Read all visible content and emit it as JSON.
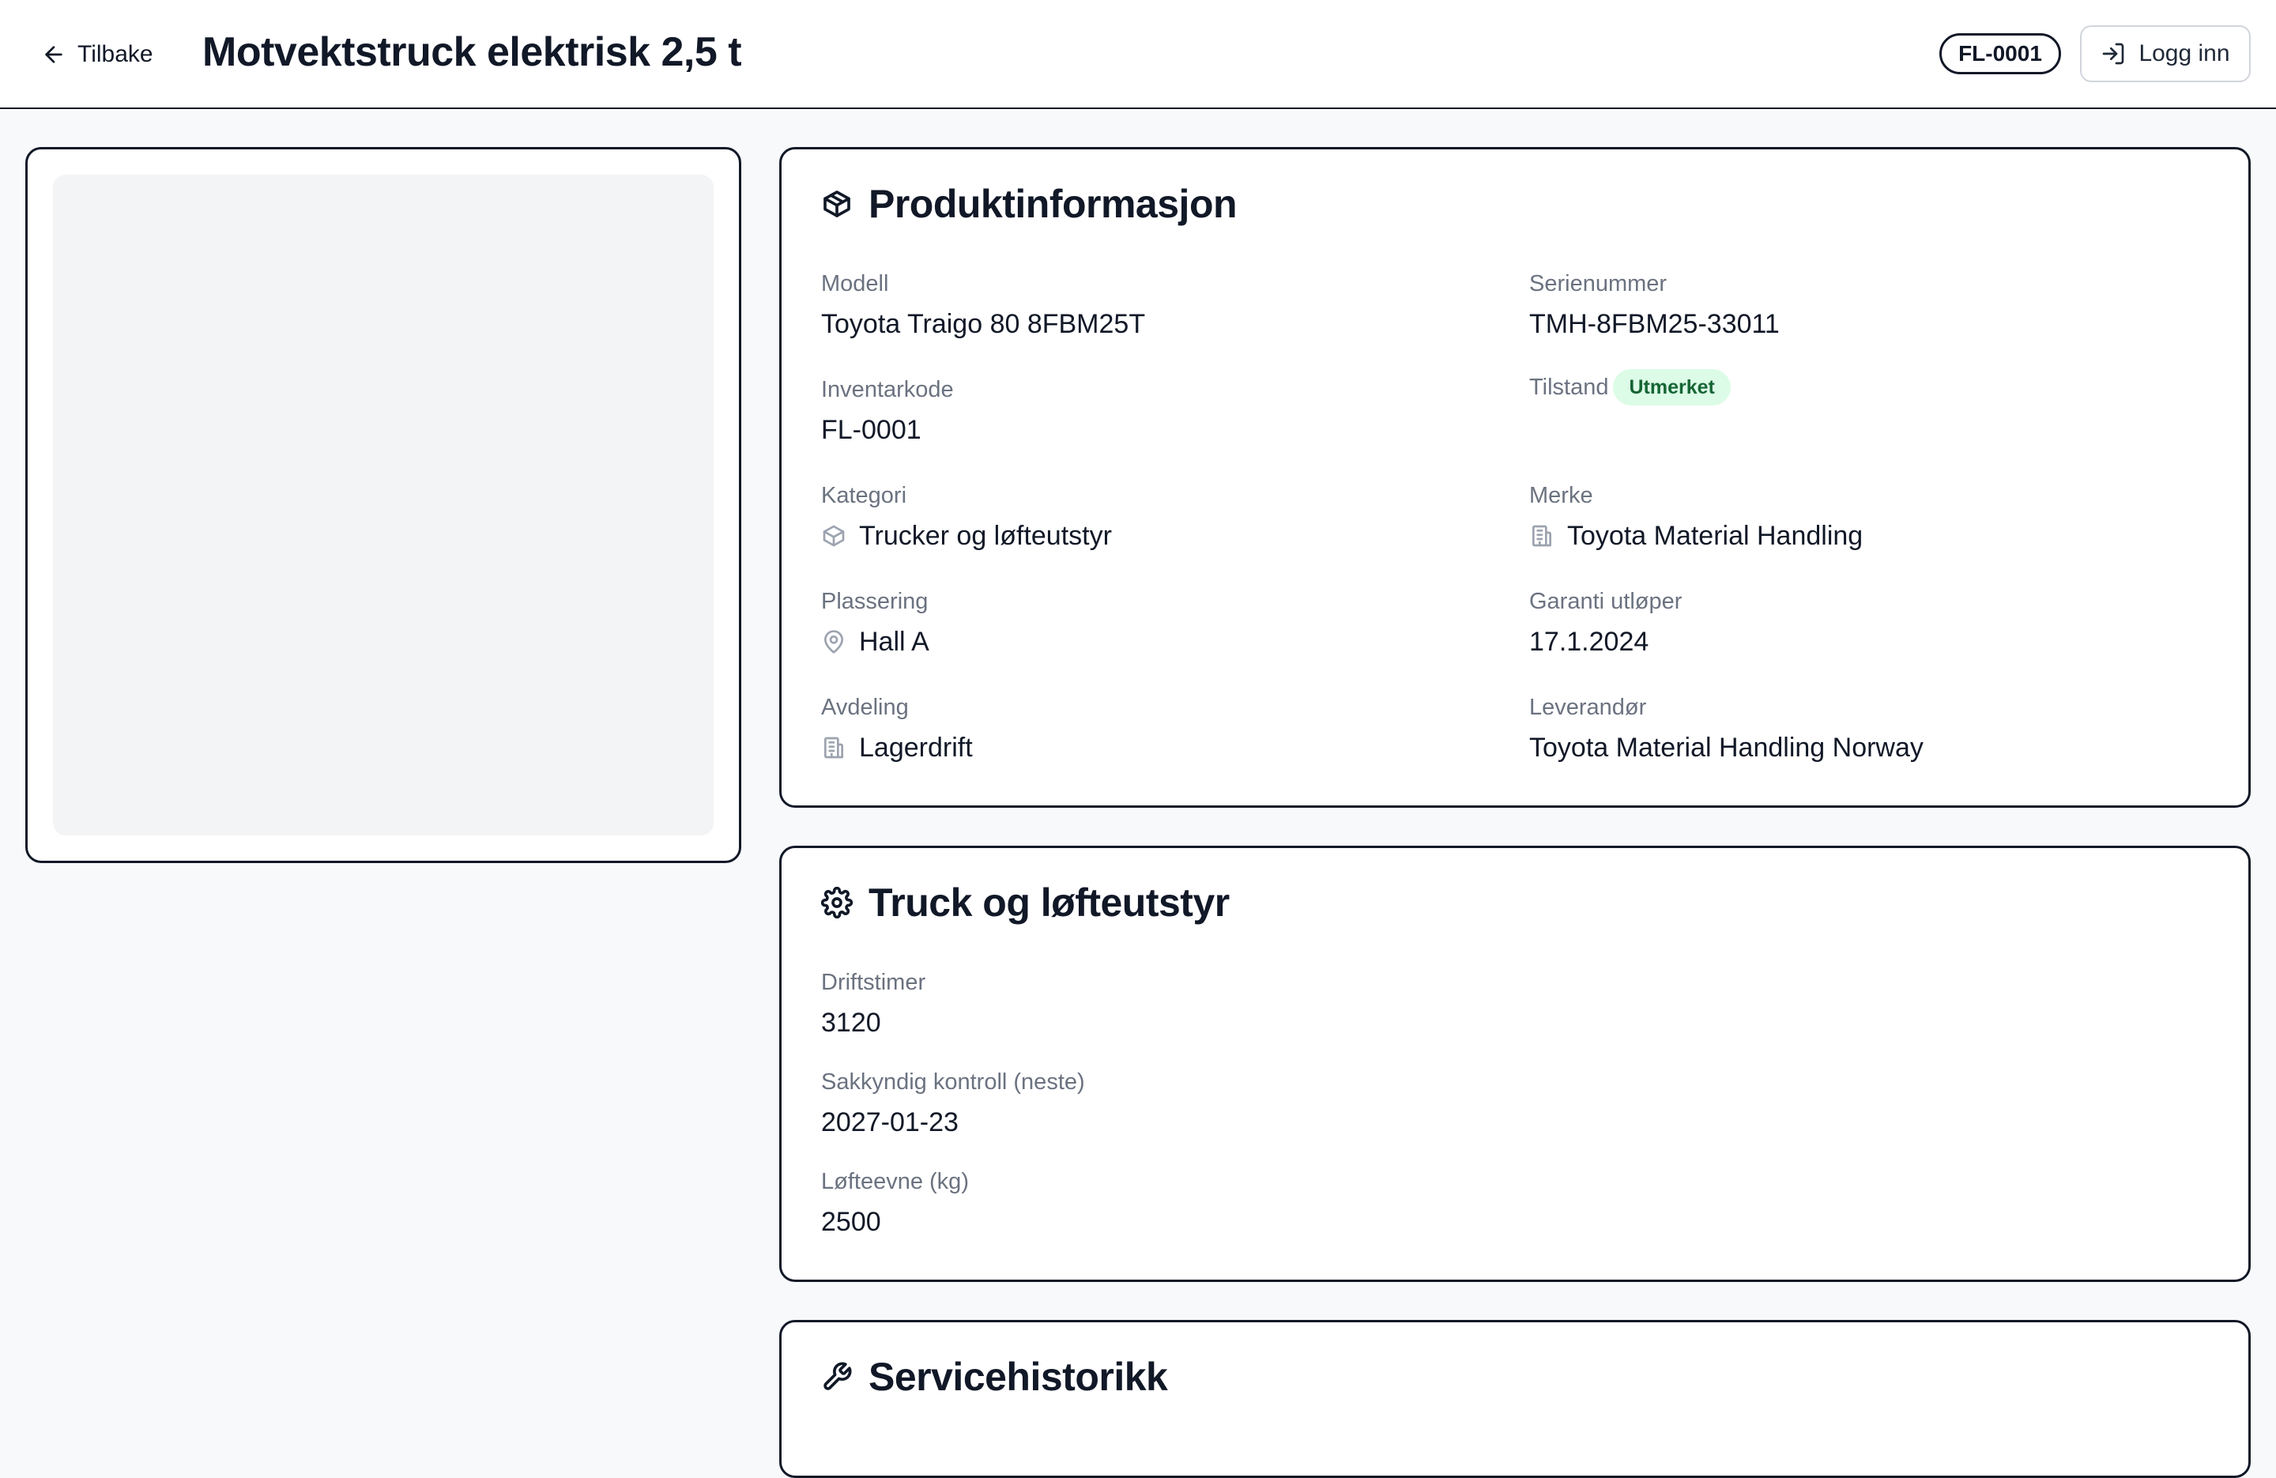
{
  "header": {
    "back_label": "Tilbake",
    "title": "Motvektstruck elektrisk 2,5 t",
    "code": "FL-0001",
    "login_label": "Logg inn"
  },
  "product_info": {
    "title": "Produktinformasjon",
    "model_label": "Modell",
    "model": "Toyota Traigo 80 8FBM25T",
    "serial_label": "Serienummer",
    "serial": "TMH-8FBM25-33011",
    "inventory_label": "Inventarkode",
    "inventory": "FL-0001",
    "condition_label": "Tilstand",
    "condition": "Utmerket",
    "category_label": "Kategori",
    "category": "Trucker og løfteutstyr",
    "brand_label": "Merke",
    "brand": "Toyota Material Handling",
    "location_label": "Plassering",
    "location": "Hall A",
    "warranty_label": "Garanti utløper",
    "warranty": "17.1.2024",
    "department_label": "Avdeling",
    "department": "Lagerdrift",
    "supplier_label": "Leverandør",
    "supplier": "Toyota Material Handling Norway"
  },
  "truck": {
    "title": "Truck og løfteutstyr",
    "hours_label": "Driftstimer",
    "hours": "3120",
    "inspection_label": "Sakkyndig kontroll (neste)",
    "inspection": "2027-01-23",
    "capacity_label": "Løfteevne (kg)",
    "capacity": "2500"
  },
  "service": {
    "title": "Servicehistorikk"
  },
  "colors": {
    "accent": "#111827",
    "status_bg": "#dcfce7",
    "status_text": "#166534",
    "muted": "#6b7280"
  }
}
